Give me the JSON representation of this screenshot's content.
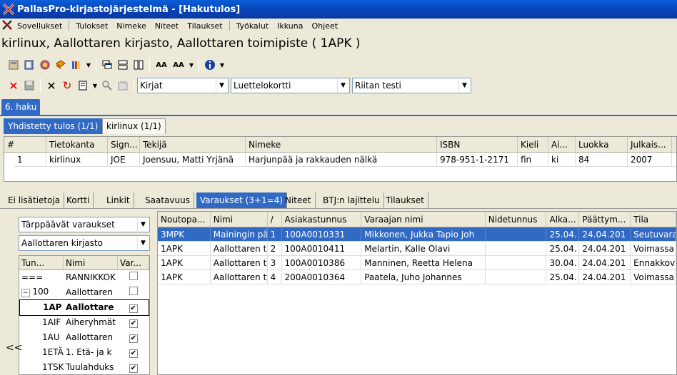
{
  "window": {
    "title": "PallasPro-kirjastojärjestelmä - [Hakutulos]"
  },
  "menu": [
    "Sovellukset",
    "Tulokset",
    "Nimeke",
    "Niteet",
    "Tilaukset",
    "Työkalut",
    "Ikkuna",
    "Ohjeet"
  ],
  "heading": "kirlinux, Aallottaren kirjasto, Aallottaren toimipiste ( 1APK )",
  "toolbar2": {
    "combo1": "Kirjat",
    "combo2": "Luettelokortti",
    "combo3": "Riitan testi"
  },
  "haku_tab": "6. haku",
  "result_tabs": [
    "Yhdistetty tulos (1/1)",
    "kirlinux (1/1)"
  ],
  "results": {
    "headers": [
      "#",
      "Tietokanta",
      "Sign...",
      "Tekijä",
      "Nimeke",
      "ISBN",
      "Kieli",
      "Ai...",
      "Luokka",
      "Julkais..."
    ],
    "rows": [
      [
        "1",
        "kirlinux",
        "JOE",
        "Joensuu, Matti Yrjänä",
        "Harjunpää ja rakkauden nälkä",
        "978-951-1-2171",
        "fin",
        "ki",
        "84",
        "2007"
      ]
    ]
  },
  "detail_tabs": [
    "Ei lisätietoja",
    "Kortti",
    "Linkit",
    "Saatavuus",
    "Varaukset (3+1=4)",
    "Niteet",
    "BTJ:n lajittelu",
    "Tilaukset"
  ],
  "left": {
    "filter1": "Tärppäävät varaukset",
    "filter2": "Aallottaren kirjasto",
    "tree_headers": [
      "Tun...",
      "Nimi",
      "Var..."
    ],
    "tree_rows": [
      {
        "code": "===",
        "name": "RANNIKKOK",
        "checked": false
      },
      {
        "code": "100",
        "name": "Aallottaren",
        "checked": false
      },
      {
        "code": "1AP",
        "name": "Aallottare",
        "checked": true
      },
      {
        "code": "1AIF",
        "name": "Aiheryhmät",
        "checked": true
      },
      {
        "code": "1AU",
        "name": "Aallottaren",
        "checked": true
      },
      {
        "code": "1ETÄ",
        "name": "1. Etä- ja k",
        "checked": true
      },
      {
        "code": "1TSK",
        "name": "Tuulahduks",
        "checked": true
      }
    ],
    "collapse": "<<"
  },
  "reservations": {
    "headers": [
      "Noutopa...",
      "Nimi",
      "/",
      "Asiakastunnus",
      "Varaajan nimi",
      "Nidetunnus",
      "Alka...",
      "Päättym...",
      "Tila"
    ],
    "rows": [
      [
        "3MPK",
        "Mainingin pä",
        "1",
        "100A0010331",
        "Mikkonen, Jukka Tapio Joh",
        "",
        "25.04.",
        "24.04.201",
        "Seutuvara"
      ],
      [
        "1APK",
        "Aallottaren t",
        "2",
        "100A0010411",
        "Melartin, Kalle Olavi",
        "",
        "25.04.",
        "24.04.201",
        "Voimassa"
      ],
      [
        "1APK",
        "Aallottaren t",
        "3",
        "100A0010386",
        "Manninen, Reetta Helena",
        "",
        "30.04.",
        "24.04.201",
        "Ennakkov"
      ],
      [
        "1APK",
        "Aallottaren t",
        "4",
        "200A0010364",
        "Paatela, Juho Johannes",
        "",
        "25.04.",
        "24.04.201",
        "Voimassa"
      ]
    ]
  },
  "colors": {
    "selection": "#316ac5",
    "titlebar": "#0a5fd8"
  }
}
